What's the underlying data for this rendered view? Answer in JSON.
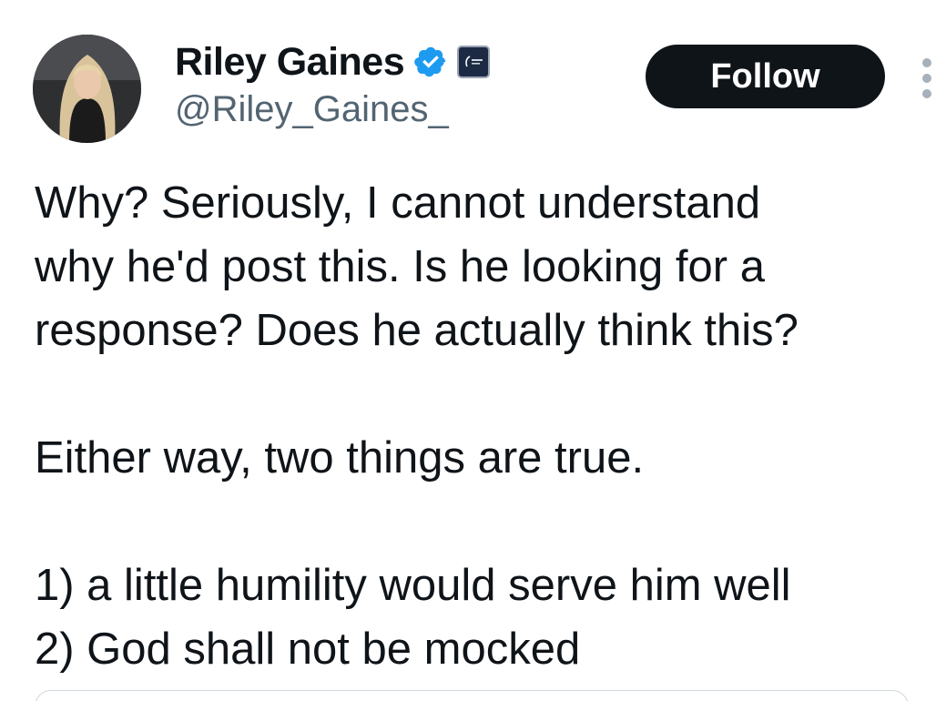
{
  "author": {
    "display_name": "Riley Gaines",
    "handle": "@Riley_Gaines_",
    "verified_icon": "verified-badge-icon",
    "affiliate_icon": "affiliate-badge-icon",
    "verified_color": "#1d9bf0"
  },
  "actions": {
    "follow_label": "Follow",
    "more_icon": "more-options-icon"
  },
  "tweet": {
    "lines": [
      "Why? Seriously, I cannot understand",
      "why he'd post this. Is he looking for a",
      "response? Does he actually think this?",
      "",
      "Either way, two things are true.",
      "",
      "1) a little humility would serve him well",
      "2) God shall not be mocked"
    ]
  }
}
